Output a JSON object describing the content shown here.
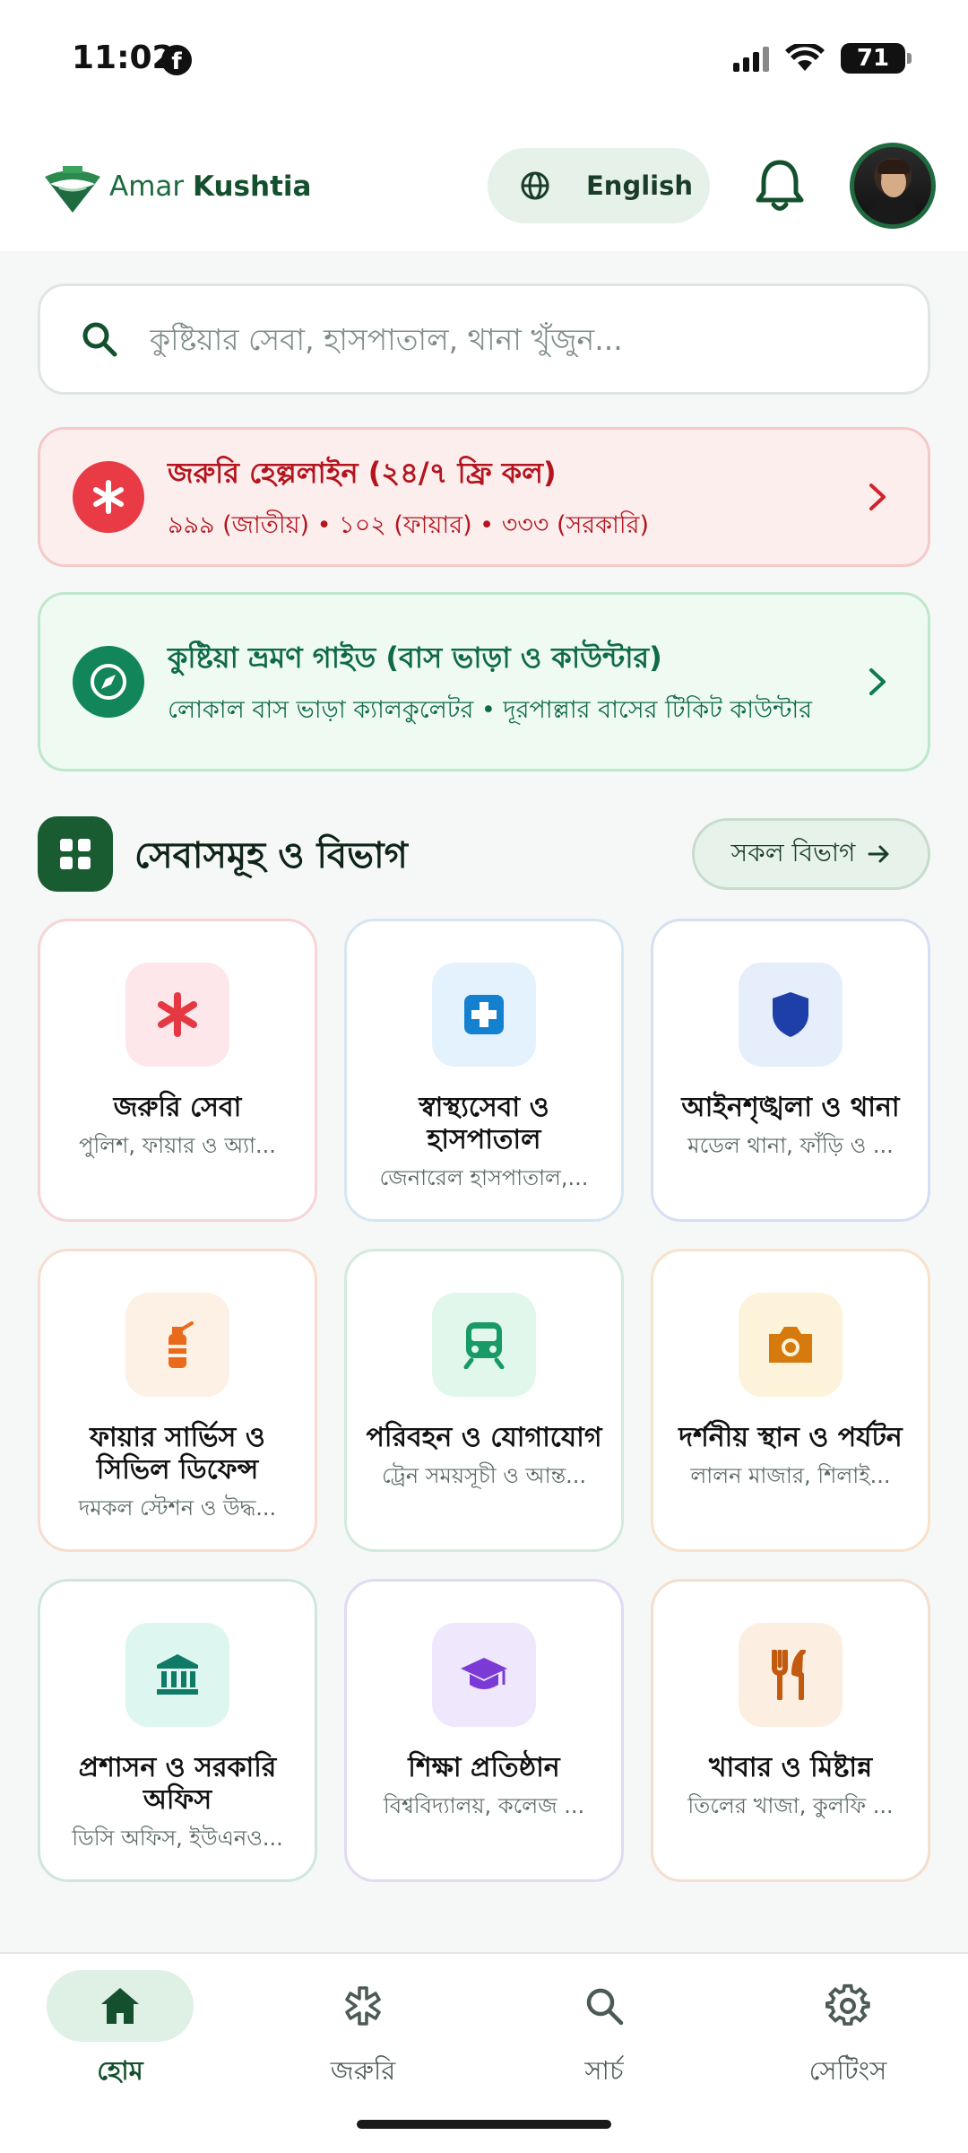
{
  "status_bar": {
    "time": "11:02",
    "battery": "71"
  },
  "header": {
    "app_name_part1": "Amar ",
    "app_name_part2": "Kushtia",
    "language_label": "English"
  },
  "search": {
    "placeholder": "কুষ্টিয়ার সেবা, হাসপাতাল, থানা খুঁজুন..."
  },
  "emergency_banner": {
    "title": "জরুরি হেল্পলাইন (২৪/৭ ফ্রি কল)",
    "subtitle": "৯৯৯ (জাতীয়) • ১০২ (ফায়ার) • ৩৩৩ (সরকারি)"
  },
  "travel_banner": {
    "title": "কুষ্টিয়া ভ্রমণ গাইড (বাস ভাড়া ও কাউন্টার)",
    "subtitle": "লোকাল বাস ভাড়া ক্যালকুলেটর • দূরপাল্লার বাসের টিকিট কাউন্টার"
  },
  "services_section": {
    "title": "সেবাসমূহ ও বিভাগ",
    "all_button": "সকল বিভাগ"
  },
  "categories": [
    {
      "title": "জরুরি সেবা",
      "subtitle": "পুলিশ, ফায়ার ও অ্যা...",
      "icon": "asterisk-icon",
      "color": "#e53843",
      "bg": "#fde7ea",
      "border": "#f7d4d6"
    },
    {
      "title": "স্বাস্থ্যসেবা ও হাসপাতাল",
      "subtitle": "জেনারেল হাসপাতাল,...",
      "icon": "medical-cross-icon",
      "color": "#1481d0",
      "bg": "#e3f2fc",
      "border": "#d5e6f3"
    },
    {
      "title": "আইনশৃঙ্খলা ও থানা",
      "subtitle": "মডেল থানা, ফাঁড়ি ও ...",
      "icon": "shield-icon",
      "color": "#1e3fa8",
      "bg": "#e6edfb",
      "border": "#d6dff2"
    },
    {
      "title": "ফায়ার সার্ভিস ও সিভিল ডিফেন্স",
      "subtitle": "দমকল স্টেশন ও উদ্ধ...",
      "icon": "fire-extinguisher-icon",
      "color": "#ea6a1c",
      "bg": "#fdf0e4",
      "border": "#f8dccd"
    },
    {
      "title": "পরিবহন ও যোগাযোগ",
      "subtitle": "ট্রেন সময়সূচী ও আন্ত...",
      "icon": "train-icon",
      "color": "#179a63",
      "bg": "#e2f7ec",
      "border": "#d3eadd"
    },
    {
      "title": "দর্শনীয় স্থান ও পর্যটন",
      "subtitle": "লালন মাজার, শিলাই...",
      "icon": "camera-icon",
      "color": "#d67a0d",
      "bg": "#fdf2da",
      "border": "#f6e3c9"
    },
    {
      "title": "প্রশাসন ও সরকারি অফিস",
      "subtitle": "ডিসি অফিস, ইউএনও...",
      "icon": "institution-icon",
      "color": "#0f7a66",
      "bg": "#ddf6f0",
      "border": "#cfe6df"
    },
    {
      "title": "শিক্ষা প্রতিষ্ঠান",
      "subtitle": "বিশ্ববিদ্যালয়, কলেজ ...",
      "icon": "graduation-cap-icon",
      "color": "#7b3ad6",
      "bg": "#efe8fc",
      "border": "#e1daf3"
    },
    {
      "title": "খাবার ও মিষ্টান্ন",
      "subtitle": "তিলের খাজা, কুলফি ...",
      "icon": "fork-knife-icon",
      "color": "#c25a10",
      "bg": "#fcefe2",
      "border": "#f4dece"
    }
  ],
  "bottom_nav": {
    "items": [
      {
        "label": "হোম",
        "icon": "home-icon",
        "active": true
      },
      {
        "label": "জরুরি",
        "icon": "asterisk-outline-icon",
        "active": false
      },
      {
        "label": "সার্চ",
        "icon": "search-icon",
        "active": false
      },
      {
        "label": "সেটিংস",
        "icon": "gear-icon",
        "active": false
      }
    ]
  },
  "colors": {
    "brand_green": "#1a5c31",
    "emergency_red": "#e83b45",
    "travel_green": "#12855a"
  }
}
